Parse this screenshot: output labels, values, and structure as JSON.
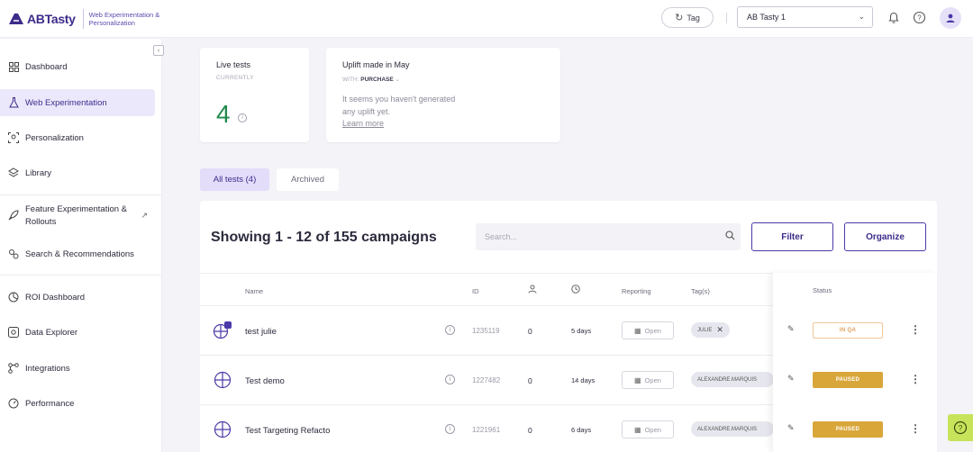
{
  "brand": {
    "name": "ABTasty",
    "subtitle": "Web Experimentation & Personalization"
  },
  "header": {
    "tag_label": "Tag",
    "account": "AB Tasty 1",
    "icons": [
      "bell-icon",
      "help-icon",
      "user-icon"
    ]
  },
  "sidebar": {
    "items": [
      {
        "label": "Dashboard",
        "icon": "dashboard-icon",
        "active": false
      },
      {
        "label": "Web Experimentation",
        "icon": "flask-icon",
        "active": true
      },
      {
        "label": "Personalization",
        "icon": "personalization-icon",
        "active": false
      },
      {
        "label": "Library",
        "icon": "library-icon",
        "active": false
      },
      {
        "label": "Feature Experimentation & Rollouts",
        "icon": "rocket-icon",
        "active": false
      },
      {
        "label": "Search & Recommendations",
        "icon": "recommendations-icon",
        "active": false
      },
      {
        "label": "ROI Dashboard",
        "icon": "roi-icon",
        "active": false
      },
      {
        "label": "Data Explorer",
        "icon": "data-explorer-icon",
        "active": false
      },
      {
        "label": "Integrations",
        "icon": "integrations-icon",
        "active": false
      },
      {
        "label": "Performance",
        "icon": "performance-icon",
        "active": false
      }
    ]
  },
  "stats": {
    "live_tests": {
      "title": "Live tests",
      "subtitle": "CURRENTLY",
      "value": "4"
    },
    "uplift": {
      "title": "Uplift made in May",
      "with_label": "WITH:",
      "metric": "PURCHASE",
      "message": "It seems you haven't generated any uplift yet.",
      "link": "Learn more"
    }
  },
  "tabs": [
    {
      "label": "All tests (4)",
      "active": true
    },
    {
      "label": "Archived",
      "active": false
    }
  ],
  "campaigns": {
    "title": "Showing 1 - 12 of 155 campaigns",
    "search_placeholder": "Search...",
    "filter_label": "Filter",
    "organize_label": "Organize",
    "columns": {
      "name": "Name",
      "id": "ID",
      "reporting": "Reporting",
      "tags": "Tag(s)",
      "status": "Status"
    },
    "rows": [
      {
        "name": "test julie",
        "id": "1235119",
        "visitors": "0",
        "duration": "5 days",
        "reporting": "Open",
        "tag": "JULIE",
        "tag_removable": true,
        "status": "IN QA",
        "status_type": "qa"
      },
      {
        "name": "Test demo",
        "id": "1227482",
        "visitors": "0",
        "duration": "14 days",
        "reporting": "Open",
        "tag": "ALEXANDRE.MARQUIS",
        "tag_removable": false,
        "status": "PAUSED",
        "status_type": "paused"
      },
      {
        "name": "Test Targeting Refacto",
        "id": "1221961",
        "visitors": "0",
        "duration": "6 days",
        "reporting": "Open",
        "tag": "ALEXANDRE.MARQUIS",
        "tag_removable": false,
        "status": "PAUSED",
        "status_type": "paused"
      }
    ]
  },
  "colors": {
    "accent": "#3d2b8a",
    "live_number": "#1f8a4c",
    "paused": "#d9a63a",
    "help_fab": "#c6e35a"
  }
}
